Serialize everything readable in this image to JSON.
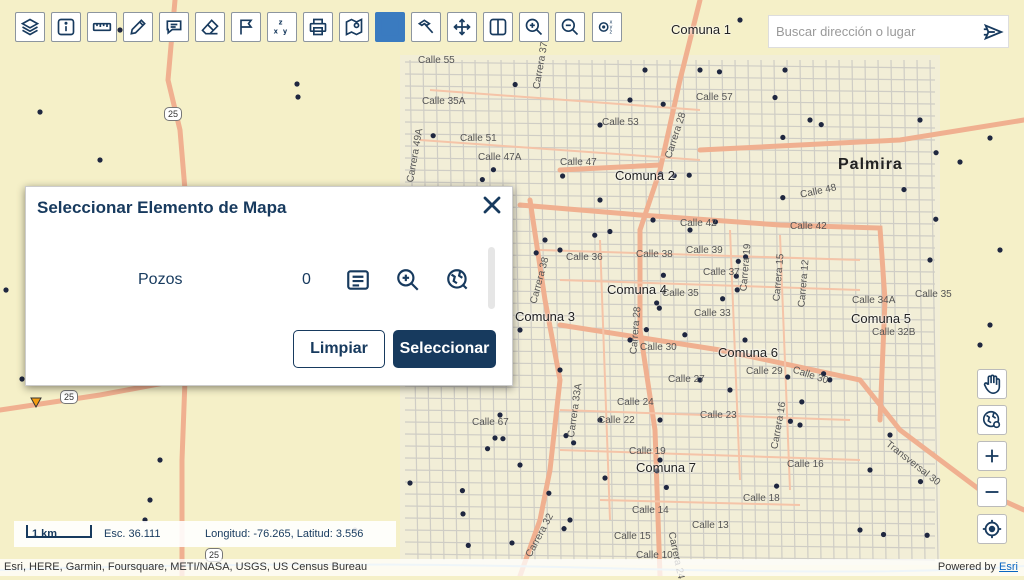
{
  "toolbar": {
    "tools": [
      {
        "name": "layers-icon",
        "active": false
      },
      {
        "name": "info-icon",
        "active": false
      },
      {
        "name": "measure-ruler-icon",
        "active": false
      },
      {
        "name": "draw-pencil-icon",
        "active": false
      },
      {
        "name": "chat-comment-icon",
        "active": false
      },
      {
        "name": "eraser-icon",
        "active": false
      },
      {
        "name": "flag-icon",
        "active": false
      },
      {
        "name": "xyz-coordinates-icon",
        "active": false
      },
      {
        "name": "print-icon",
        "active": false
      },
      {
        "name": "map-pin-icon",
        "active": false
      },
      {
        "name": "select-square-icon",
        "active": true
      },
      {
        "name": "tools-hammer-icon",
        "active": false
      },
      {
        "name": "pan-arrows-icon",
        "active": false
      },
      {
        "name": "split-view-icon",
        "active": false
      },
      {
        "name": "zoom-in-icon",
        "active": false
      },
      {
        "name": "zoom-out-icon",
        "active": false
      },
      {
        "name": "xyz-point-icon",
        "active": false
      }
    ]
  },
  "search": {
    "placeholder": "Buscar dirección o lugar"
  },
  "map": {
    "city_label": "Palmira",
    "comunas": [
      "Comuna 1",
      "Comuna 2",
      "Comuna 3",
      "Comuna 4",
      "Comuna 5",
      "Comuna 6",
      "Comuna 7"
    ],
    "streets": [
      "Calle 42",
      "Calle 42",
      "Calle 47",
      "Calle 48",
      "Calle 30",
      "Calle 30",
      "Carrera 28",
      "Carrera 33A",
      "Carrera 32",
      "Carrera 24",
      "Transversal 30",
      "Calle 57",
      "Calle 35A",
      "Calle 53",
      "Calle 51",
      "Calle 47A",
      "Carrera 37",
      "Carrera 49A",
      "Calle 39",
      "Calle 38",
      "Calle 37",
      "Calle 35",
      "Calle 33",
      "Calle 36",
      "Calle 34A",
      "Calle 35",
      "Calle 32B",
      "Calle 27",
      "Calle 29",
      "Calle 24",
      "Calle 23",
      "Calle 22",
      "Calle 19",
      "Calle 18",
      "Calle 16",
      "Calle 14",
      "Calle 13",
      "Calle 10",
      "Calle 15",
      "Calle 55",
      "Carrera 19",
      "Carrera 15",
      "Carrera 12",
      "Carrera 16",
      "Carrera 28",
      "Carrera 38",
      "Calle 67"
    ],
    "route_shields": [
      "25",
      "25",
      "25"
    ],
    "accent_road": "#f0b090",
    "background": "#f5f0c8"
  },
  "dialog": {
    "title": "Seleccionar Elemento de Mapa",
    "layer_name": "Pozos",
    "count": "0",
    "clear_label": "Limpiar",
    "select_label": "Seleccionar",
    "accent": "#173a5e"
  },
  "right_controls": [
    "pan-hand-icon",
    "globe-icon",
    "zoom-in-plus-icon",
    "zoom-out-minus-icon",
    "locate-crosshair-icon"
  ],
  "scalebar": {
    "bar_label": "1 km",
    "scale_text": "Esc. 36.111",
    "coords_text": "Longitud: -76.265, Latitud: 3.556"
  },
  "attribution": {
    "sources": "Esri, HERE, Garmin, Foursquare, METI/NASA, USGS, US Census Bureau",
    "powered_prefix": "Powered by ",
    "powered_link": "Esri"
  }
}
